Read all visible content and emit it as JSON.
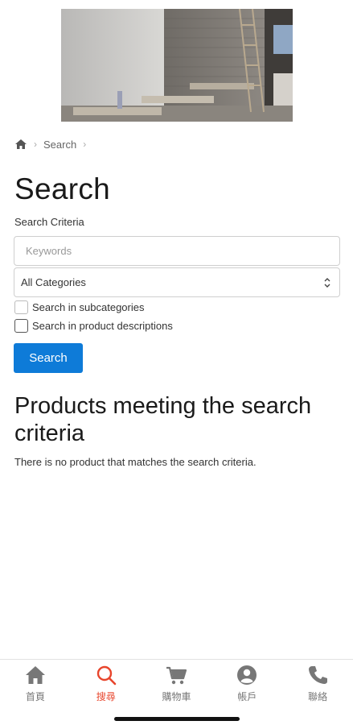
{
  "breadcrumb": {
    "home_icon": "home-icon",
    "items": [
      "Search"
    ]
  },
  "page": {
    "title": "Search",
    "criteria_label": "Search Criteria"
  },
  "form": {
    "keywords_placeholder": "Keywords",
    "keywords_value": "",
    "category_selected": "All Categories",
    "subcategories_label": "Search in subcategories",
    "subcategories_checked": false,
    "descriptions_label": "Search in product descriptions",
    "descriptions_checked": false,
    "search_button": "Search"
  },
  "results": {
    "title": "Products meeting the search criteria",
    "empty_message": "There is no product that matches the search criteria."
  },
  "tabbar": {
    "active_color": "#e8452c",
    "inactive_color": "#777777",
    "tabs": [
      {
        "label": "首頁",
        "icon": "home-icon",
        "active": false
      },
      {
        "label": "搜尋",
        "icon": "search-icon",
        "active": true
      },
      {
        "label": "購物車",
        "icon": "cart-icon",
        "active": false
      },
      {
        "label": "帳戶",
        "icon": "account-icon",
        "active": false
      },
      {
        "label": "聯絡",
        "icon": "phone-icon",
        "active": false
      }
    ]
  },
  "colors": {
    "primary_button": "#0e7bd8"
  }
}
